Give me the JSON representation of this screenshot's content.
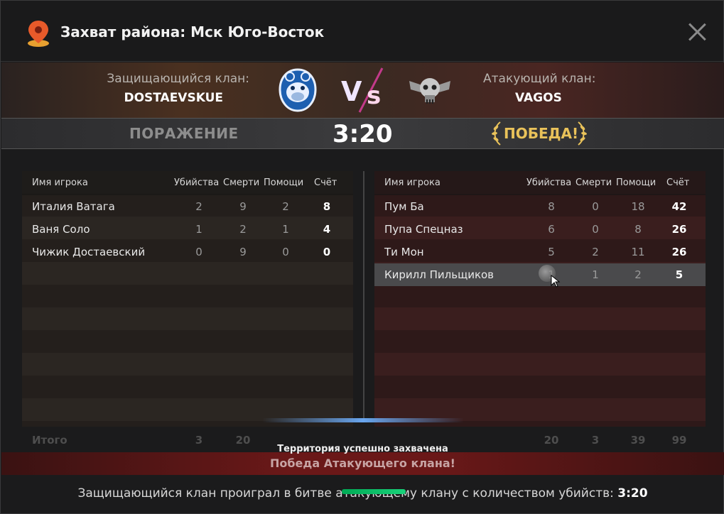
{
  "window": {
    "title": "Захват района: Мск Юго-Восток"
  },
  "clans": {
    "defender_label": "Защищающийся клан:",
    "defender_name": "DOSTAEVSKUE",
    "attacker_label": "Атакующий клан:",
    "attacker_name": "VAGOS"
  },
  "result": {
    "defender_result": "ПОРАЖЕНИЕ",
    "score": "3:20",
    "attacker_result": "ПОБЕДА!"
  },
  "columns": [
    "Имя игрока",
    "Убийства",
    "Смерти",
    "Помощи",
    "Счёт"
  ],
  "defenders": [
    {
      "name": "Италия Ватага",
      "kills": "2",
      "deaths": "9",
      "assists": "2",
      "score": "8"
    },
    {
      "name": "Ваня Соло",
      "kills": "1",
      "deaths": "2",
      "assists": "1",
      "score": "4"
    },
    {
      "name": "Чижик Достаевский",
      "kills": "0",
      "deaths": "9",
      "assists": "0",
      "score": "0"
    }
  ],
  "attackers": [
    {
      "name": "Пум Ба",
      "kills": "8",
      "deaths": "0",
      "assists": "18",
      "score": "42"
    },
    {
      "name": "Пупа Спецназ",
      "kills": "6",
      "deaths": "0",
      "assists": "8",
      "score": "26"
    },
    {
      "name": "Ти Мон",
      "kills": "5",
      "deaths": "2",
      "assists": "11",
      "score": "26"
    },
    {
      "name": "Кирилл Пильщиков",
      "kills": "1",
      "deaths": "1",
      "assists": "2",
      "score": "5"
    }
  ],
  "totals": {
    "label": "Итого",
    "defenders": {
      "kills": "3",
      "deaths": "20"
    },
    "attackers": {
      "kills": "20",
      "deaths": "3",
      "assists": "39",
      "score": "99"
    }
  },
  "banner": {
    "territory": "Территория успешно захвачена",
    "win": "Победа Атакующего клана!"
  },
  "footer": {
    "text": "Защищающийся клан проиграл в битве атакующему клану с количеством убийств:",
    "kills": "3:20"
  }
}
